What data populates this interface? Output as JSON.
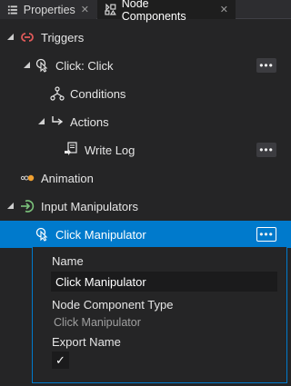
{
  "tabs": [
    {
      "label": "Properties",
      "close": "✕",
      "active": false
    },
    {
      "label": "Node Components",
      "close": "✕",
      "active": true
    }
  ],
  "tree": {
    "triggers": "Triggers",
    "click_trigger": "Click: Click",
    "conditions": "Conditions",
    "actions": "Actions",
    "write_log": "Write Log",
    "animation": "Animation",
    "input_manipulators": "Input Manipulators",
    "click_manipulator": "Click Manipulator",
    "more": "•••"
  },
  "properties": {
    "name_label": "Name",
    "name_value": "Click Manipulator",
    "type_label": "Node Component Type",
    "type_value": "Click Manipulator",
    "export_label": "Export Name",
    "export_checked": "✓"
  },
  "colors": {
    "accent": "#007acc",
    "trigger_icon": "#e05a5a",
    "animation_icon": "#f0a030",
    "manipulator_icon": "#7cc37c"
  }
}
